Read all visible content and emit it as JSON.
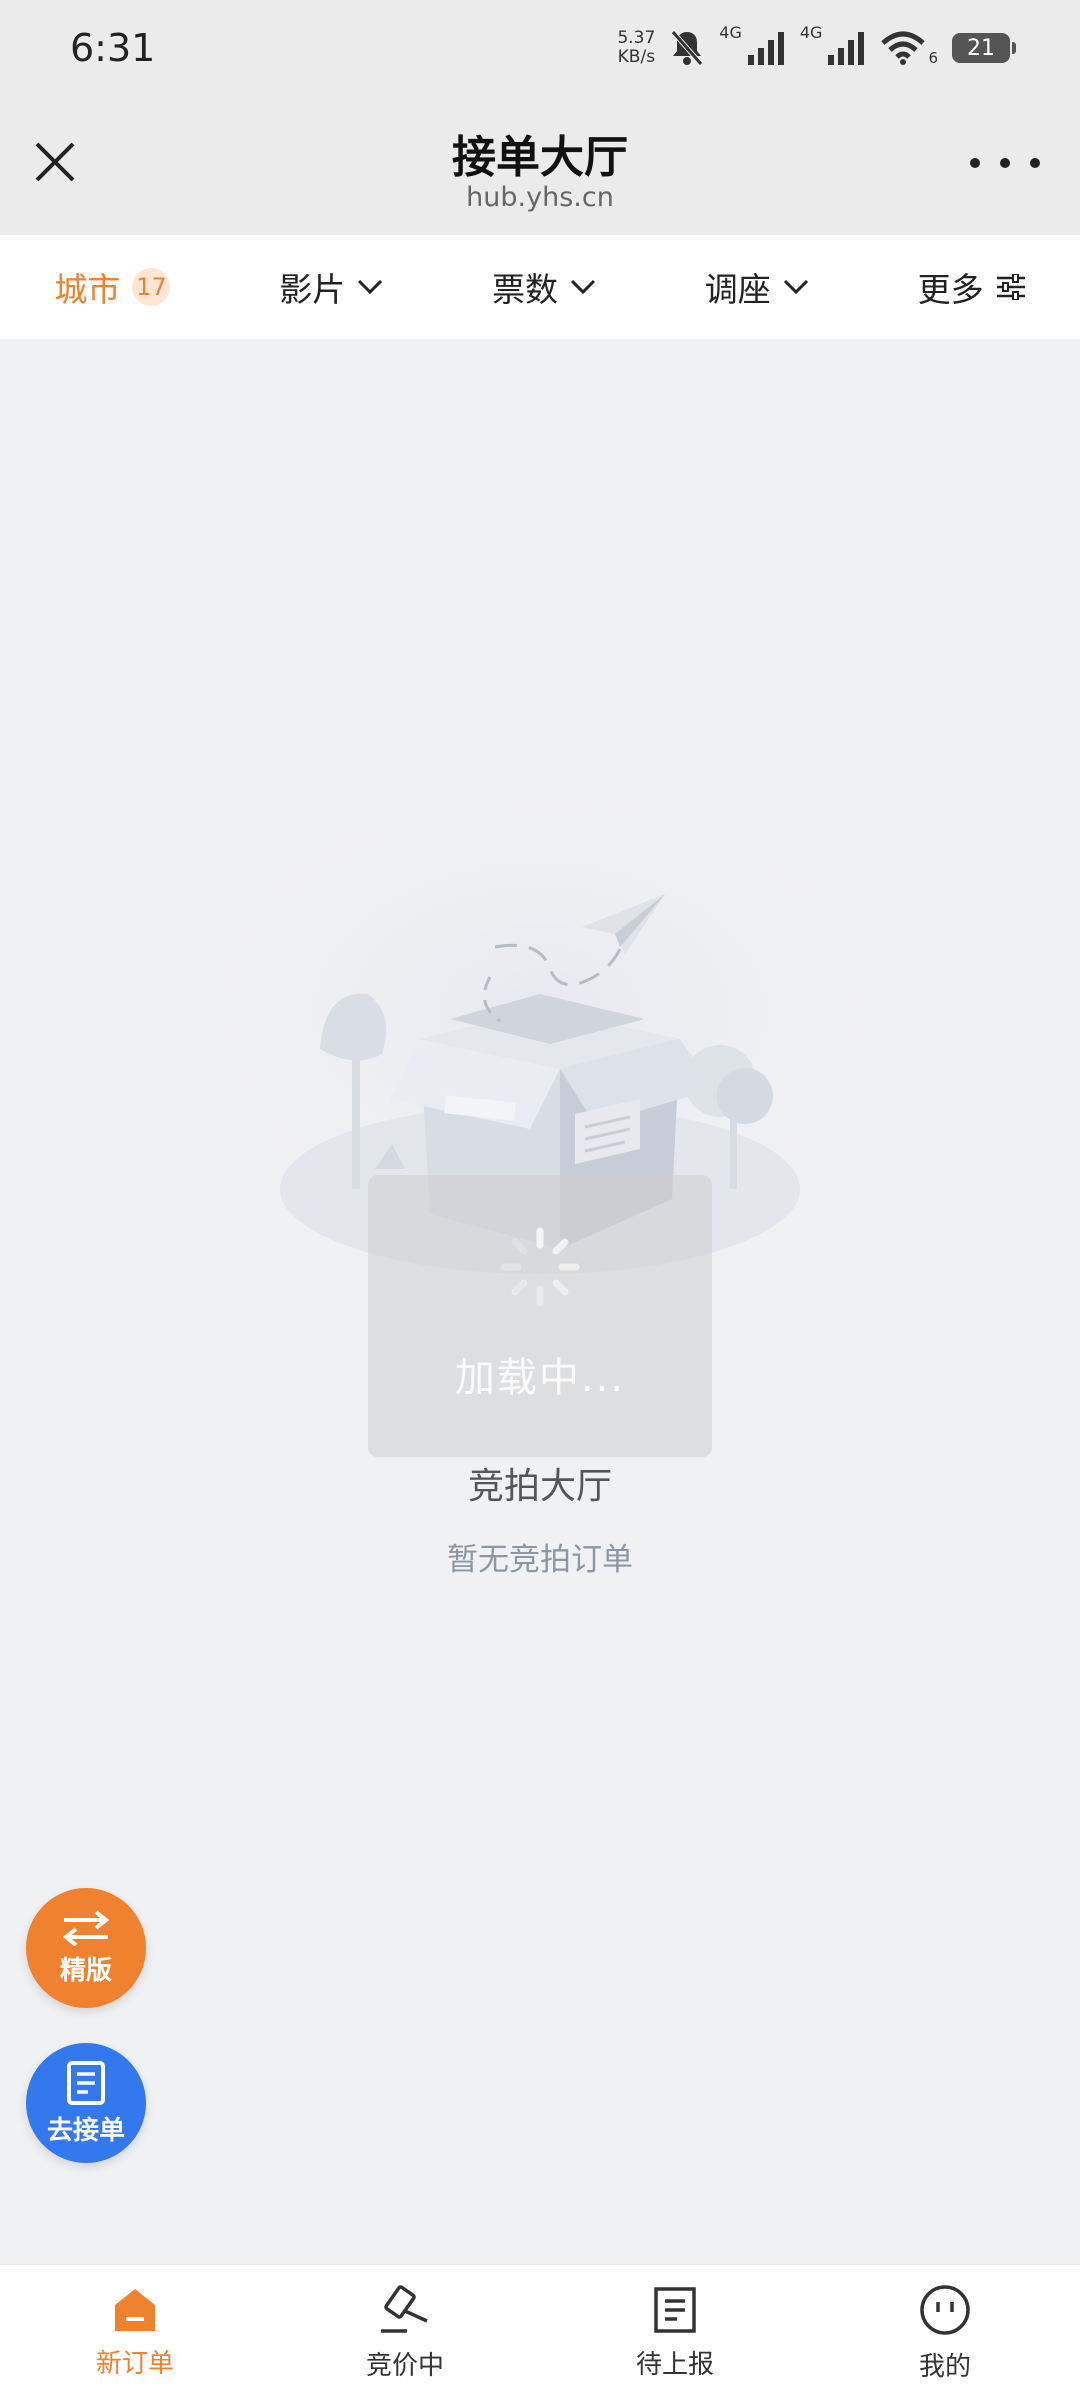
{
  "status_bar": {
    "time": "6:31",
    "net_speed_value": "5.37",
    "net_speed_unit": "KB/s",
    "signal_1_label": "4G",
    "signal_2_label": "4G",
    "wifi_label": "6",
    "battery": "21"
  },
  "header": {
    "title": "接单大厅",
    "url": "hub.yhs.cn"
  },
  "filters": [
    {
      "label": "城市",
      "badge": "17"
    },
    {
      "label": "影片"
    },
    {
      "label": "票数"
    },
    {
      "label": "调座"
    },
    {
      "label": "更多"
    }
  ],
  "loading": {
    "text": "加载中..."
  },
  "empty_state": {
    "title": "竞拍大厅",
    "subtitle": "暂无竞拍订单"
  },
  "fabs": {
    "version_label": "精版",
    "take_order_label": "去接单"
  },
  "tabs": [
    {
      "label": "新订单",
      "icon": "home-icon",
      "active": true
    },
    {
      "label": "竞价中",
      "icon": "auction-hammer-icon"
    },
    {
      "label": "待上报",
      "icon": "document-icon"
    },
    {
      "label": "我的",
      "icon": "profile-icon"
    }
  ],
  "colors": {
    "accent": "#f0822f",
    "fab_blue": "#3478ee",
    "background": "#f0f1f3"
  }
}
